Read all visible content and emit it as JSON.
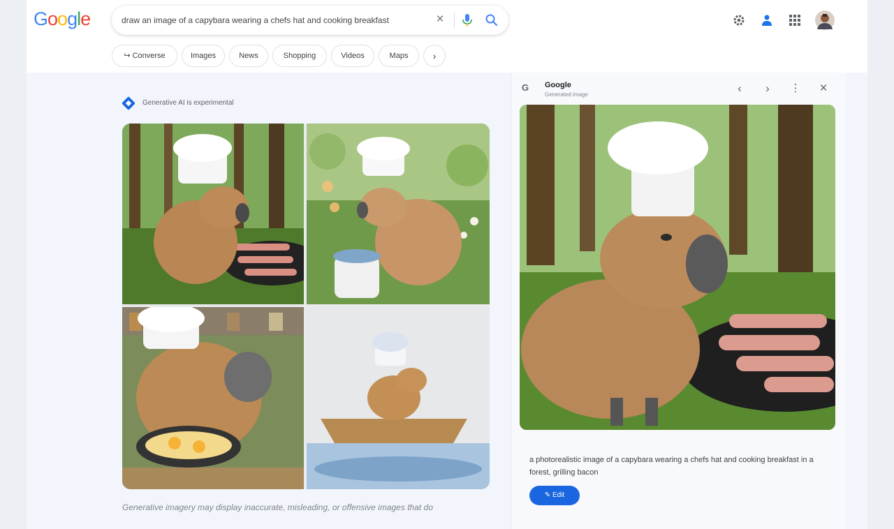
{
  "header": {
    "logo_letters": [
      {
        "ch": "G",
        "color": "#4285F4"
      },
      {
        "ch": "o",
        "color": "#EA4335"
      },
      {
        "ch": "o",
        "color": "#FBBC05"
      },
      {
        "ch": "g",
        "color": "#4285F4"
      },
      {
        "ch": "l",
        "color": "#34A853"
      },
      {
        "ch": "e",
        "color": "#EA4335"
      }
    ],
    "search_query": "draw an image of a capybara wearing a chefs hat and cooking breakfast",
    "icons": [
      "close-icon",
      "mic-icon",
      "search-icon",
      "settings-icon",
      "labs-icon",
      "apps-icon",
      "avatar"
    ]
  },
  "tabs": [
    {
      "label": "↪ Converse"
    },
    {
      "label": "Images"
    },
    {
      "label": "News"
    },
    {
      "label": "Shopping"
    },
    {
      "label": "Videos"
    },
    {
      "label": "Maps"
    },
    {
      "label": "›"
    }
  ],
  "main": {
    "ai_notice": "Generative AI is experimental",
    "image_tiles": [
      {
        "description": "capybara chef in forest grilling bacon"
      },
      {
        "description": "capybara chef in meadow stirring pot"
      },
      {
        "description": "capybara chef in kitchen frying eggs"
      },
      {
        "description": "capybara chef in a boat on water"
      }
    ],
    "disclaimer": "Generative imagery may display inaccurate, misleading, or offensive images that do"
  },
  "panel": {
    "source_title": "Google",
    "source_subtitle": "Generated image",
    "caption": "a photorealistic image of a capybara wearing a chefs hat and cooking breakfast in a forest, grilling bacon",
    "edit_label": "Edit"
  },
  "colors": {
    "accent_blue": "#1a66e0",
    "content_bg": "#f2f5fb"
  }
}
